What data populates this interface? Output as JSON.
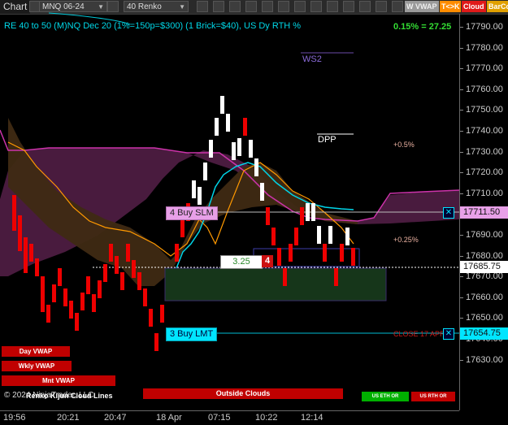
{
  "toolbar": {
    "chart_label": "Chart",
    "instrument": "MNQ 06-24",
    "bar_type": "40 Renko",
    "tags": {
      "wvwap": "W VWAP",
      "tk": "T<>K",
      "cloud": "Cloud",
      "barco": "BarCo"
    }
  },
  "chart": {
    "title": "RE 40 to 50 (M)NQ Dec 20 (1%=150p=$300) (1 Brick=$40), US Dy RTH %",
    "pct_readout": "0.15% = 27.25",
    "ws2": "WS2",
    "dpp": "DPP",
    "pct_pos": "+0.5%",
    "pct_pos2": "+0.25%",
    "buy_slm": "4 Buy SLM",
    "buy_lmt": "3 Buy LMT",
    "pos_value": "3.25",
    "pos_qty": "4",
    "close_label": "CLOSE 17 APR",
    "outside_clouds": "Outside Clouds",
    "copyright": "© 2024 NinjaTrader, LLC",
    "bottom_overlay": "Renko Kijun Cloud Lines"
  },
  "buttons": {
    "day_vwap": "Day VWAP",
    "wkly_vwap": "Wkly VWAP",
    "mnt_vwap": "Mnt VWAP",
    "us_eth": "US ETH OR",
    "us_rth": "US RTH OR"
  },
  "price_axis": {
    "ticks": [
      "17790.00",
      "17780.00",
      "17770.00",
      "17760.00",
      "17750.00",
      "17740.00",
      "17730.00",
      "17720.00",
      "17710.00",
      "17700.00",
      "17690.00",
      "17680.00",
      "17670.00",
      "17660.00",
      "17650.00",
      "17640.00",
      "17630.00"
    ],
    "tag_buy_slm": "17711.50",
    "tag_last": "17685.75",
    "tag_buy_lmt": "17654.75"
  },
  "time_axis": {
    "ticks": [
      "19:56",
      "20:21",
      "20:47",
      "18 Apr",
      "07:15",
      "10:22",
      "12:14"
    ]
  },
  "colors": {
    "up": "#ffffff",
    "down": "#ee0000",
    "cloud_purple": "#5a1f4a",
    "cloud_brown": "#4a3418",
    "cyan": "#00e5ff",
    "orange": "#ff9900",
    "magenta": "#cc33aa"
  }
}
